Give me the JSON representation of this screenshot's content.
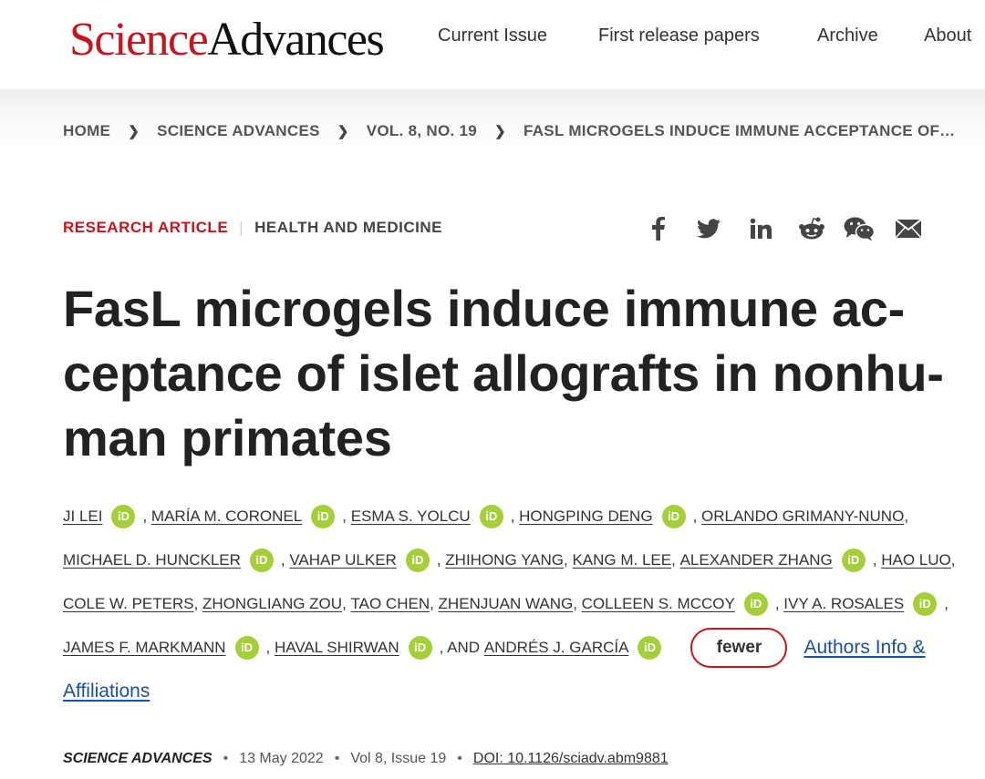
{
  "header": {
    "logo_part1": "Science",
    "logo_part2": "Advances",
    "nav": [
      "Current Issue",
      "First release papers",
      "Archive",
      "About"
    ]
  },
  "breadcrumb": [
    "HOME",
    "SCIENCE ADVANCES",
    "VOL. 8, NO. 19",
    "FASL MICROGELS INDUCE IMMUNE ACCEPTANCE OF…"
  ],
  "article": {
    "type": "RESEARCH ARTICLE",
    "subject": "HEALTH AND MEDICINE",
    "title_lines": [
      "FasL microgels induce immune ac-",
      "ceptance of islet allografts in nonhu-",
      "man primates"
    ]
  },
  "share_icons": [
    "facebook-icon",
    "twitter-icon",
    "linkedin-icon",
    "reddit-icon",
    "wechat-icon",
    "email-icon"
  ],
  "authors": {
    "row1": [
      {
        "name": "JI LEI",
        "orcid": true
      },
      {
        "name": "MARÍA M. CORONEL",
        "orcid": true
      },
      {
        "name": "ESMA S. YOLCU",
        "orcid": true
      },
      {
        "name": "HONGPING DENG",
        "orcid": true
      },
      {
        "name": "ORLANDO GRIMANY-NUNO",
        "orcid": false
      }
    ],
    "row2": [
      {
        "name": "MICHAEL D. HUNCKLER",
        "orcid": true
      },
      {
        "name": "VAHAP ULKER",
        "orcid": true
      },
      {
        "name": "ZHIHONG YANG",
        "orcid": false
      },
      {
        "name": "KANG M. LEE",
        "orcid": false
      },
      {
        "name": "ALEXANDER ZHANG",
        "orcid": true
      },
      {
        "name": "HAO LUO",
        "orcid": false
      }
    ],
    "row3": [
      {
        "name": "COLE W. PETERS",
        "orcid": false
      },
      {
        "name": "ZHONGLIANG ZOU",
        "orcid": false
      },
      {
        "name": "TAO CHEN",
        "orcid": false
      },
      {
        "name": "ZHENJUAN WANG",
        "orcid": false
      },
      {
        "name": "COLLEEN S. MCCOY",
        "orcid": true
      },
      {
        "name": "IVY A. ROSALES",
        "orcid": true
      }
    ],
    "row4": [
      {
        "name": "JAMES F. MARKMANN",
        "orcid": true
      },
      {
        "name": "HAVAL SHIRWAN",
        "orcid": true
      }
    ],
    "and_text": ", AND",
    "last_author": "ANDRÉS J. GARCÍA",
    "orcid_label": "iD",
    "fewer_label": "fewer",
    "affiliations_line1": "Authors Info &",
    "affiliations_line2": "Affiliations"
  },
  "citation": {
    "journal": "SCIENCE ADVANCES",
    "date": "13 May 2022",
    "volume": "Vol 8, Issue 19",
    "doi": "DOI: 10.1126/sciadv.abm9881"
  },
  "colors": {
    "brand_red": "#c4161c",
    "orcid_green": "#a6ce39",
    "link_blue": "#1a4fa3"
  }
}
